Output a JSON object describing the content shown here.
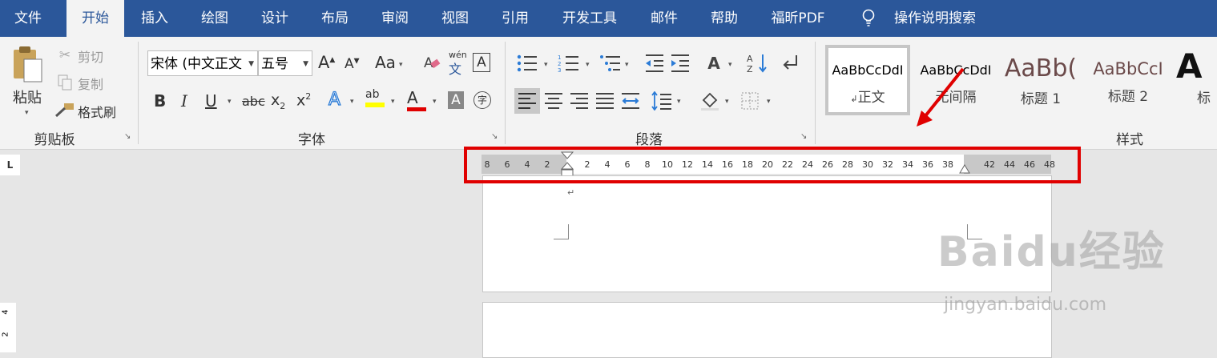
{
  "menu": {
    "tabs": [
      "文件",
      "开始",
      "插入",
      "绘图",
      "设计",
      "布局",
      "审阅",
      "视图",
      "引用",
      "开发工具",
      "邮件",
      "帮助",
      "福昕PDF"
    ],
    "active_tab": "开始",
    "search_label": "操作说明搜索"
  },
  "clipboard": {
    "paste_label": "粘贴",
    "cut_label": "剪切",
    "copy_label": "复制",
    "format_painter_label": "格式刷",
    "group_label": "剪贴板"
  },
  "font": {
    "font_name": "宋体 (中文正文",
    "font_size": "五号",
    "grow_label": "A",
    "shrink_label": "A",
    "case_label": "Aa",
    "phonetic_top": "wén",
    "phonetic_bottom": "文",
    "border_label": "A",
    "bold_label": "B",
    "italic_label": "I",
    "underline_label": "U",
    "strike_label": "abc",
    "subscript_label": "x",
    "subscript_sub": "2",
    "superscript_label": "x",
    "superscript_sup": "2",
    "effects_label": "A",
    "highlight_label": "ab",
    "font_color_label": "A",
    "shading_label": "A",
    "enclose_label": "字",
    "group_label": "字体"
  },
  "paragraph": {
    "group_label": "段落"
  },
  "styles": {
    "items": [
      {
        "preview": "AaBbCcDdI",
        "name": "正文",
        "selected": true
      },
      {
        "preview": "AaBbCcDdI",
        "name": "无间隔",
        "selected": false
      },
      {
        "preview": "AaBb(",
        "name": "标题 1",
        "selected": false
      },
      {
        "preview": "AaBbCcI",
        "name": "标题 2",
        "selected": false
      },
      {
        "preview": "A",
        "name": "标",
        "selected": false
      }
    ],
    "group_label": "样式"
  },
  "ruler": {
    "left_ticks": [
      "8",
      "6",
      "4",
      "2"
    ],
    "ticks": [
      "2",
      "4",
      "6",
      "8",
      "10",
      "12",
      "14",
      "16",
      "18",
      "20",
      "22",
      "24",
      "26",
      "28",
      "30",
      "32",
      "34",
      "36",
      "38"
    ],
    "right_ticks": [
      "42",
      "44",
      "46",
      "48"
    ],
    "corner_label": "L"
  },
  "vertical_ruler": {
    "labels": [
      "4",
      "2"
    ]
  },
  "document": {
    "paragraph_mark": "↵"
  },
  "watermark": {
    "text": "Baidu经验",
    "sub": "jingyan.baidu.com"
  },
  "colors": {
    "brand_blue": "#2b579a",
    "annotation_red": "#e00000",
    "highlight_yellow": "#ffff00",
    "font_red": "#e00000"
  }
}
